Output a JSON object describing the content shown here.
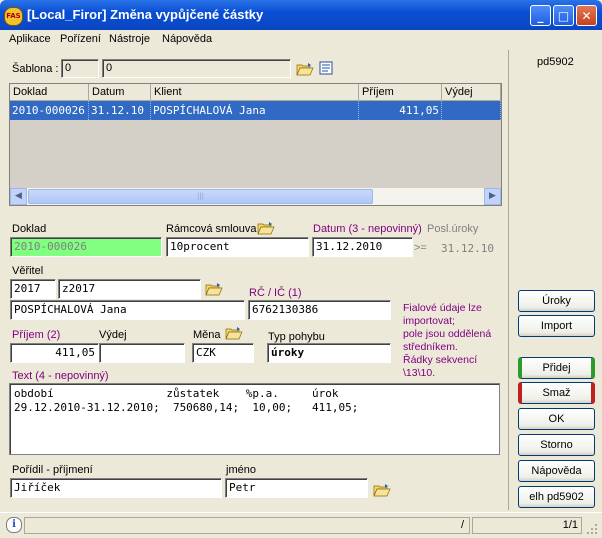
{
  "window": {
    "title": "[Local_Firor] Změna vypůjčené částky",
    "app_icon_text": "FAS",
    "minimize": "_",
    "maximize": "□",
    "close": "✕"
  },
  "menu": [
    "Aplikace",
    "Pořízení",
    "Nástroje",
    "Nápověda"
  ],
  "sablona": {
    "label": "Šablona :",
    "value1": "0",
    "value2": "0"
  },
  "grid": {
    "columns": [
      "Doklad",
      "Datum",
      "Klient",
      "Příjem",
      "Výdej"
    ],
    "rows": [
      {
        "doklad": "2010-000026",
        "datum": "31.12.10",
        "klient": "POSPÍCHALOVÁ Jana",
        "prijem": "411,05",
        "vydej": ""
      }
    ],
    "scroll_left": "◀",
    "scroll_right": "▶",
    "thumb_grip": "|||"
  },
  "form": {
    "doklad_label": "Doklad",
    "doklad_value": "2010-000026",
    "ramcova_label": "Rámcová smlouva",
    "ramcova_value": "10procent",
    "datum_label": "Datum (3 - nepovinný)",
    "datum_value": "31.12.2010",
    "posl_uroky_label": "Posl.úroky",
    "posl_uroky_prefix": ">=",
    "posl_uroky_value": "31.12.10",
    "veritel_label": "Věřitel",
    "veritel_code": "2017",
    "veritel_name_code": "z2017",
    "veritel_name": "POSPÍCHALOVÁ Jana",
    "rc_label": "RČ / IČ (1)",
    "rc_value": "6762130386",
    "note": "Fialové údaje lze importovat;\npole jsou oddělená středníkem.\nŘádky sekvencí \\13\\10.",
    "prijem_label": "Příjem (2)",
    "prijem_value": "411,05",
    "vydej_label": "Výdej",
    "vydej_value": "",
    "mena_label": "Měna",
    "mena_value": "CZK",
    "typ_label": "Typ pohybu",
    "typ_value": "úroky",
    "text_label": "Text (4 - nepovinný)",
    "text_value": "období                 zůstatek    %p.a.     úrok\n29.12.2010-31.12.2010;  750680,14;  10,00;   411,05;",
    "poridil_prijmeni_label": "Pořídil - příjmení",
    "poridil_prijmeni_value": "Jiříček",
    "jmeno_label": "jméno",
    "jmeno_value": "Petr"
  },
  "sidebar": {
    "id": "pd5902",
    "buttons": {
      "uroky": "Úroky",
      "import": "Import",
      "pridej": "Přidej",
      "smaz": "Smaž",
      "ok": "OK",
      "storno": "Storno",
      "napoveda": "Nápověda",
      "elh": "elh pd5902"
    }
  },
  "status": {
    "info": "i",
    "slash": "/",
    "page": "1/1"
  },
  "colors": {
    "title_bar": "#0a4fd4",
    "selection": "#316ac5",
    "green_field": "#80ff80",
    "purple_label": "#800080"
  }
}
